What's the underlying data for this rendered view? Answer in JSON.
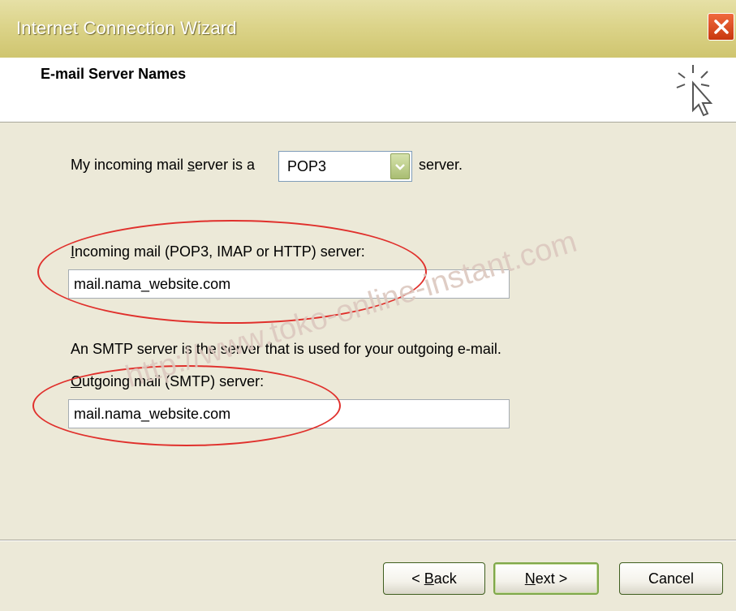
{
  "window": {
    "title": "Internet Connection Wizard"
  },
  "header": {
    "title": "E-mail Server Names"
  },
  "incoming_type": {
    "prefix": "My incoming mail ",
    "prefix_accel": "s",
    "prefix_rest": "erver is a",
    "selected": "POP3",
    "suffix": "server."
  },
  "incoming_server": {
    "label_accel": "I",
    "label_rest": "ncoming mail (POP3, IMAP or HTTP) server:",
    "value": "mail.nama_website.com"
  },
  "smtp_note": "An SMTP server is the server that is used for your outgoing e-mail.",
  "outgoing_server": {
    "label_accel": "O",
    "label_rest": "utgoing mail (SMTP) server:",
    "value": "mail.nama_website.com"
  },
  "watermark": "http://www.toko-online-instant.com",
  "buttons": {
    "back_prefix": "< ",
    "back_accel": "B",
    "back_rest": "ack",
    "next_accel": "N",
    "next_rest": "ext >",
    "cancel": "Cancel"
  },
  "colors": {
    "highlight_oval": "#e0302c",
    "title_bar": "#dcd48a"
  },
  "icons": {
    "close": "close-icon",
    "wizard": "cursor-sparkle-icon",
    "dropdown": "chevron-down-icon"
  }
}
